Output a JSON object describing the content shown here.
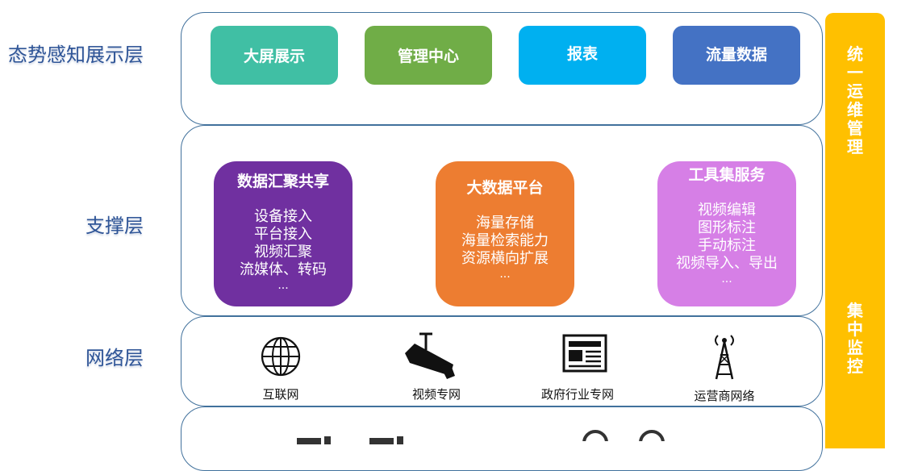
{
  "layers": {
    "display": "态势感知展示层",
    "support": "支撑层",
    "network": "网络层"
  },
  "display_tiles": [
    {
      "label": "大屏展示",
      "color": "#40bfa4"
    },
    {
      "label": "管理中心",
      "color": "#70ad47"
    },
    {
      "label": "报表",
      "color": "#00b0f0"
    },
    {
      "label": "流量数据",
      "color": "#4472c4"
    }
  ],
  "support_cards": [
    {
      "title": "数据汇聚共享",
      "color": "#7030a0",
      "items": [
        "设备接入",
        "平台接入",
        "视频汇聚",
        "流媒体、转码",
        "..."
      ]
    },
    {
      "title": "大数据平台",
      "color": "#ed7d31",
      "items": [
        "海量存储",
        "海量检索能力",
        "资源横向扩展",
        "..."
      ]
    },
    {
      "title": "工具集服务",
      "color": "#d67fe6",
      "items": [
        "视频编辑",
        "图形标注",
        "手动标注",
        "视频导入、导出",
        "..."
      ]
    }
  ],
  "network_items": [
    {
      "label": "互联网",
      "icon": "globe-icon"
    },
    {
      "label": "视频专网",
      "icon": "cctv-camera-icon"
    },
    {
      "label": "政府行业专网",
      "icon": "newspaper-icon"
    },
    {
      "label": "运营商网络",
      "icon": "cell-tower-icon"
    }
  ],
  "sidebar": {
    "top": "统一运维管理",
    "bottom": "集中监控",
    "color": "#ffc000"
  }
}
